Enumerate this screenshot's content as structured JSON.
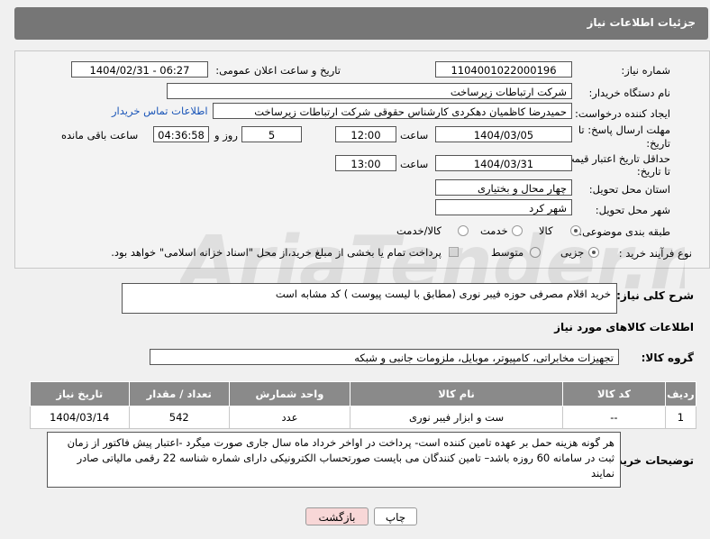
{
  "header": {
    "title": "جزئیات اطلاعات نیاز"
  },
  "form": {
    "need_number_label": "شماره نیاز:",
    "need_number": "1104001022000196",
    "announce_label": "تاریخ و ساعت اعلان عمومی:",
    "announce_value": "1404/02/31 - 06:27",
    "buyer_org_label": "نام دستگاه خریدار:",
    "buyer_org": "شرکت ارتباطات زیرساخت",
    "creator_label": "ایجاد کننده درخواست:",
    "creator": "حمیدرضا کاظمیان دهکردی کارشناس حقوقی شرکت ارتباطات زیرساخت",
    "contact_link": "اطلاعات تماس خریدار",
    "reply_deadline_label_1": "مهلت ارسال پاسخ: تا",
    "reply_deadline_label_2": "تاریخ:",
    "reply_date": "1404/03/05",
    "time_label": "ساعت",
    "reply_time": "12:00",
    "days_value": "5",
    "days_label": "روز و",
    "remaining_time": "04:36:58",
    "remaining_label": "ساعت باقی مانده",
    "price_validity_label_1": "حداقل تاریخ اعتبار قیمت:",
    "price_validity_label_2": "تا تاریخ:",
    "price_date": "1404/03/31",
    "price_time": "13:00",
    "province_label": "استان محل تحویل:",
    "province": "چهار محال و بختیاری",
    "city_label": "شهر محل تحویل:",
    "city": "شهر کرد",
    "category_label": "طبقه بندی موضوعی:",
    "category_options": [
      "کالا",
      "خدمت",
      "کالا/خدمت"
    ],
    "process_label": "نوع فرآیند خرید :",
    "process_options": [
      "جزیی",
      "متوسط"
    ],
    "payment_note": "پرداخت تمام یا بخشی از مبلغ خرید،از محل \"اسناد خزانه اسلامی\" خواهد بود."
  },
  "summary": {
    "label": "شرح کلی نیاز:",
    "text": "خرید اقلام مصرفی حوزه فیبر نوری (مطابق با لیست پیوست ) کد مشابه است"
  },
  "goods": {
    "section_title": "اطلاعات کالاهای مورد نیاز",
    "group_label": "گروه کالا:",
    "group_value": "تجهیزات مخابراتی، کامپیوتر، موبایل، ملزومات جانبی و شبکه",
    "table_headers": [
      "ردیف",
      "کد کالا",
      "نام کالا",
      "واحد شمارش",
      "تعداد / مقدار",
      "تاریخ نیاز"
    ],
    "rows": [
      [
        "1",
        "--",
        "ست و ابزار فیبر نوری",
        "عدد",
        "542",
        "1404/03/14"
      ]
    ]
  },
  "buyer_notes": {
    "label": "توضیحات خریدار:",
    "text": "هر گونه هزینه حمل بر عهده تامین کننده است- پرداخت در اواخر خرداد ماه سال جاری  صورت میگرد -اعتبار پیش فاکتور از زمان ثبت در سامانه 60  روزه باشد– تامین کنندگان می بایست صورتحساب الکترونیکی دارای شماره شناسه 22 رقمی مالیاتی صادر نمایند"
  },
  "buttons": {
    "print": "چاپ",
    "back": "بازگشت"
  },
  "watermark": {
    "text": "AriaTender.net"
  },
  "colors": {
    "header_bg": "#767676",
    "link": "#1a55b8",
    "table_header": "#8a8a8a",
    "back_button_bg": "#f8d7d7"
  }
}
